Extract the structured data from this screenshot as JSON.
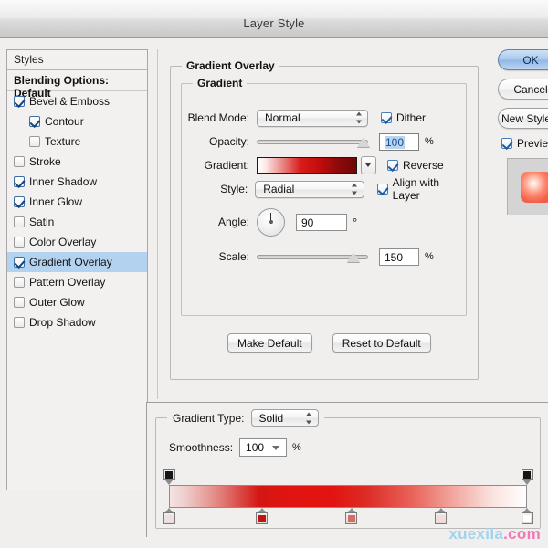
{
  "window": {
    "title": "Layer Style"
  },
  "styles_panel": {
    "header": "Styles",
    "blending_options": "Blending Options: Default",
    "items": [
      {
        "label": "Bevel & Emboss",
        "checked": true,
        "indent": false,
        "selected": false
      },
      {
        "label": "Contour",
        "checked": true,
        "indent": true,
        "selected": false
      },
      {
        "label": "Texture",
        "checked": false,
        "indent": true,
        "selected": false
      },
      {
        "label": "Stroke",
        "checked": false,
        "indent": false,
        "selected": false
      },
      {
        "label": "Inner Shadow",
        "checked": true,
        "indent": false,
        "selected": false
      },
      {
        "label": "Inner Glow",
        "checked": true,
        "indent": false,
        "selected": false
      },
      {
        "label": "Satin",
        "checked": false,
        "indent": false,
        "selected": false
      },
      {
        "label": "Color Overlay",
        "checked": false,
        "indent": false,
        "selected": false
      },
      {
        "label": "Gradient Overlay",
        "checked": true,
        "indent": false,
        "selected": true
      },
      {
        "label": "Pattern Overlay",
        "checked": false,
        "indent": false,
        "selected": false
      },
      {
        "label": "Outer Glow",
        "checked": false,
        "indent": false,
        "selected": false
      },
      {
        "label": "Drop Shadow",
        "checked": false,
        "indent": false,
        "selected": false
      }
    ]
  },
  "main_panel": {
    "section_title": "Gradient Overlay",
    "group_title": "Gradient",
    "blend_mode": {
      "label": "Blend Mode:",
      "value": "Normal"
    },
    "opacity": {
      "label": "Opacity:",
      "value": "100",
      "unit": "%",
      "slider_percent": 96
    },
    "gradient": {
      "label": "Gradient:"
    },
    "style": {
      "label": "Style:",
      "value": "Radial"
    },
    "angle": {
      "label": "Angle:",
      "value": "90",
      "unit": "°",
      "degrees": 90
    },
    "scale": {
      "label": "Scale:",
      "value": "150",
      "unit": "%",
      "slider_percent": 87
    },
    "dither": {
      "label": "Dither",
      "checked": true
    },
    "reverse": {
      "label": "Reverse",
      "checked": true
    },
    "align_with_layer": {
      "label": "Align with Layer",
      "checked": true
    },
    "make_default": "Make Default",
    "reset_to_default": "Reset to Default"
  },
  "buttons": {
    "ok": "OK",
    "cancel": "Cancel",
    "new_style": "New Style...",
    "preview": {
      "label": "Preview",
      "checked": true
    }
  },
  "gradient_editor": {
    "gradient_type": {
      "label": "Gradient Type:",
      "value": "Solid"
    },
    "smoothness": {
      "label": "Smoothness:",
      "value": "100",
      "unit": "%"
    },
    "opacity_stops": [
      {
        "position": 0,
        "opacity": "100",
        "color": "#151515"
      },
      {
        "position": 100,
        "opacity": "100",
        "color": "#151515"
      }
    ],
    "color_stops": [
      {
        "position": 0,
        "color": "#f2dedd"
      },
      {
        "position": 26,
        "color": "#c4120f"
      },
      {
        "position": 51,
        "color": "#dd6a62"
      },
      {
        "position": 76,
        "color": "#f7d9d6"
      },
      {
        "position": 100,
        "color": "#ffffff"
      }
    ]
  },
  "watermark": {
    "name": "xuexila",
    "tld": ".com"
  }
}
